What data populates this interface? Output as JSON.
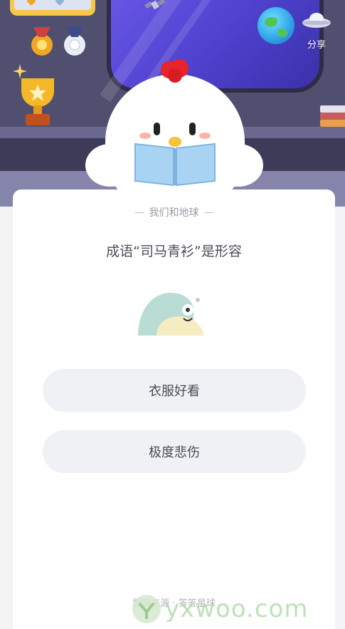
{
  "header": {
    "share_label": "分享"
  },
  "card": {
    "subtitle": "我们和地球",
    "question": "成语“司马青衫”是形容",
    "options": [
      {
        "label": "衣服好看"
      },
      {
        "label": "极度悲伤"
      }
    ],
    "source": "题目来源 · 答答星球"
  },
  "watermark": {
    "text": "yxwoo.com"
  },
  "colors": {
    "scene_bg": "#4a4868",
    "screen_purple": "#5b4ad8",
    "chicken_comb": "#e8232b",
    "book_blue": "#a9d3f2",
    "option_bg": "#f0f1f4",
    "text_main": "#4a4d57",
    "text_muted": "#9a9aa6"
  }
}
